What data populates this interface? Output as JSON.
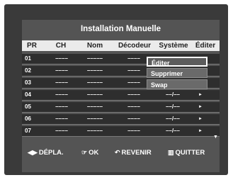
{
  "title": "Installation Manuelle",
  "columns": [
    "PR",
    "CH",
    "Nom",
    "Décodeur",
    "Système",
    "Éditer"
  ],
  "rows": [
    {
      "pr": "01",
      "ch": "––––",
      "nom": "–––––",
      "dec": "––––",
      "sys": "",
      "arrow": ""
    },
    {
      "pr": "02",
      "ch": "––––",
      "nom": "–––––",
      "dec": "––––",
      "sys": "",
      "arrow": ""
    },
    {
      "pr": "03",
      "ch": "––––",
      "nom": "–––––",
      "dec": "––––",
      "sys": "",
      "arrow": ""
    },
    {
      "pr": "04",
      "ch": "––––",
      "nom": "–––––",
      "dec": "––––",
      "sys": "––/––",
      "arrow": "►"
    },
    {
      "pr": "05",
      "ch": "––––",
      "nom": "–––––",
      "dec": "––––",
      "sys": "––/––",
      "arrow": "►"
    },
    {
      "pr": "06",
      "ch": "––––",
      "nom": "–––––",
      "dec": "––––",
      "sys": "––/––",
      "arrow": "►"
    },
    {
      "pr": "07",
      "ch": "––––",
      "nom": "–––––",
      "dec": "––––",
      "sys": "––/––",
      "arrow": "►"
    }
  ],
  "scroll_indicator": "▼",
  "edit_menu": [
    "Éditer",
    "Supprimer",
    "Swap"
  ],
  "footer": {
    "move_icon": "◀▶",
    "move_label": "DÉPLA.",
    "ok_icon": "☞",
    "ok_label": "OK",
    "back_icon": "↶",
    "back_label": "REVENIR",
    "exit_icon": "▥",
    "exit_label": "QUITTER"
  },
  "colors": {
    "screen_bg": "#545454",
    "header_bg": "#ebebeb",
    "row_bg": "#2e2e2e"
  }
}
